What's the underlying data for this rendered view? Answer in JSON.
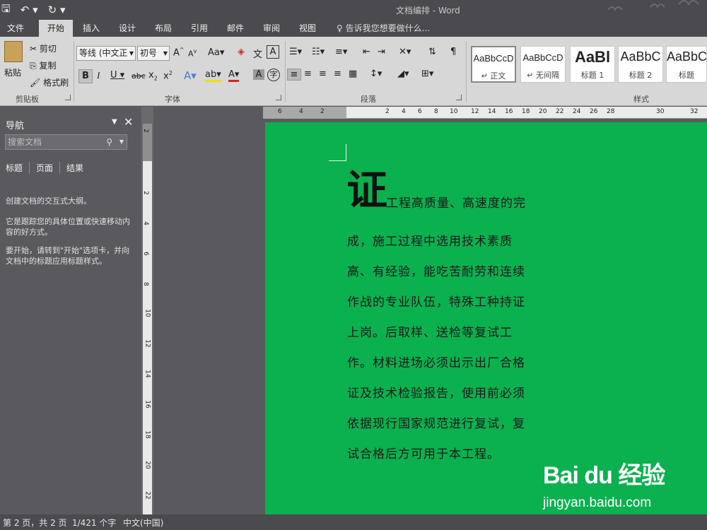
{
  "qat": {
    "save_icon": "save-icon",
    "undo_icon": "undo-icon",
    "redo_icon": "redo-icon"
  },
  "window_title": "文档编排 - Word",
  "tabs": [
    "文件",
    "开始",
    "插入",
    "设计",
    "布局",
    "引用",
    "邮件",
    "审阅",
    "视图"
  ],
  "tell_me": "告诉我您想要做什么...",
  "clipboard": {
    "paste": "粘贴",
    "cut": "剪切",
    "copy": "复制",
    "format_painter": "格式刷",
    "label": "剪贴板"
  },
  "font": {
    "name": "等线 (中文正",
    "size": "初号",
    "aa": "Aa",
    "wen": "文",
    "label": "字体"
  },
  "paragraph": {
    "label": "段落"
  },
  "styles": {
    "label": "样式",
    "items": [
      {
        "sample": "AaBbCcD",
        "name": "↵ 正文"
      },
      {
        "sample": "AaBbCcD",
        "name": "↵ 无间隔"
      },
      {
        "sample": "AaBl",
        "name": "标题 1"
      },
      {
        "sample": "AaBbC",
        "name": "标题 2"
      },
      {
        "sample": "AaBbC",
        "name": "标题"
      }
    ]
  },
  "nav": {
    "title": "导航",
    "search_placeholder": "搜索文档",
    "tabs": [
      "标题",
      "页面",
      "结果"
    ],
    "text1": "创建文档的交互式大纲。",
    "text2": "它是跟踪您的具体位置或快速移动内容的好方式。",
    "text3": "要开始，请转到\"开始\"选项卡，并向文档中的标题应用标题样式。"
  },
  "vruler_numbers": [
    "2",
    "2",
    "4",
    "6",
    "8",
    "10",
    "12",
    "14",
    "16",
    "18",
    "20",
    "22"
  ],
  "hruler_numbers": [
    "6",
    "4",
    "2",
    "2",
    "4",
    "6",
    "8",
    "10",
    "12",
    "14",
    "16",
    "18",
    "20",
    "22",
    "24",
    "26",
    "28",
    "30",
    "32"
  ],
  "document": {
    "dropcap": "证",
    "lines": [
      "工程高质量、高速度的完",
      "成，施工过程中选用技术素质",
      "高、有经验，能吃苦耐劳和连续",
      "作战的专业队伍，特殊工种持证",
      "上岗。后取样、送检等复试工",
      "作。材料进场必须出示出厂合格",
      "证及技术检验报告，使用前必须",
      "依据现行国家规范进行复试，复",
      "试合格后方可用于本工程。"
    ],
    "page_color": "#0bb04f"
  },
  "watermark": {
    "logo": "Bai du 经验",
    "url": "jingyan.baidu.com"
  },
  "status": {
    "page": "第 2 页，共 2 页",
    "words": "1/421 个字",
    "lang": "中文(中国)"
  }
}
